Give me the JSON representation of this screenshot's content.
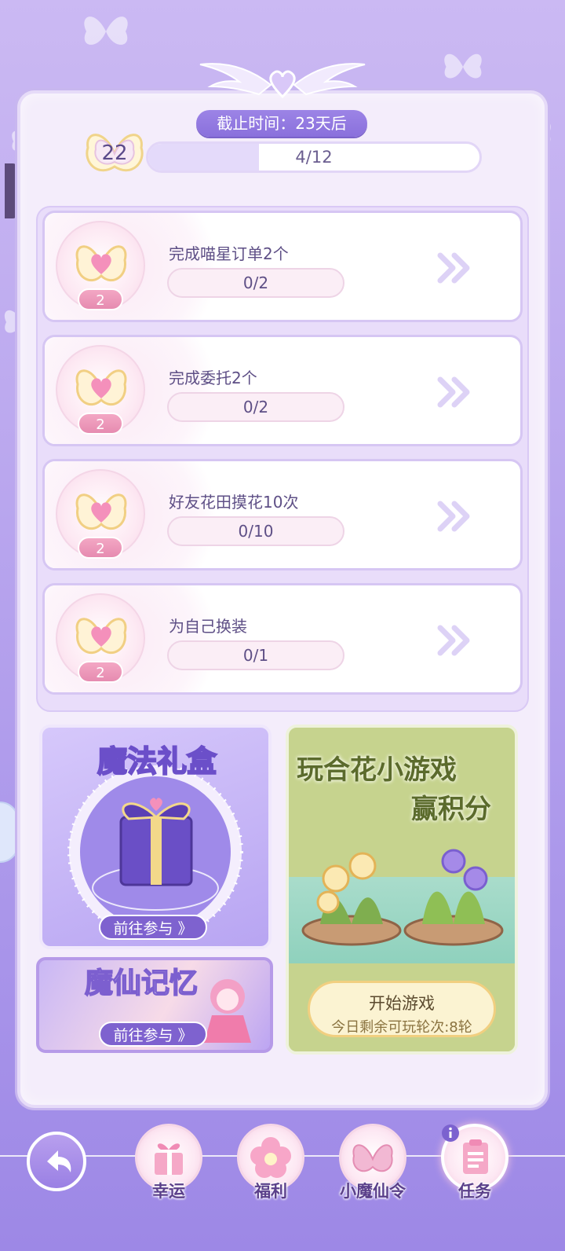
{
  "header": {
    "deadline": "截止时间：23天后",
    "level": "22",
    "progress_text": "4/12",
    "progress_fraction": 0.3333
  },
  "tasks": [
    {
      "title": "完成喵星订单2个",
      "progress": "0/2",
      "points": "2"
    },
    {
      "title": "完成委托2个",
      "progress": "0/2",
      "points": "2"
    },
    {
      "title": "好友花田摸花10次",
      "progress": "0/10",
      "points": "2"
    },
    {
      "title": "为自己换装",
      "progress": "0/1",
      "points": "2"
    }
  ],
  "events": {
    "magic_box": {
      "title": "魔法礼盒",
      "button": "前往参与 》"
    },
    "memory": {
      "title": "魔仙记忆",
      "button": "前往参与 》"
    },
    "mini_game": {
      "title_line1": "玩合花小游戏",
      "title_line2": "赢积分",
      "button": "开始游戏",
      "remaining": "今日剩余可玩轮次:8轮"
    }
  },
  "nav": [
    {
      "label": "幸运",
      "icon": "gift-icon"
    },
    {
      "label": "福利",
      "icon": "flower-icon"
    },
    {
      "label": "小魔仙令",
      "icon": "butterfly-badge-icon"
    },
    {
      "label": "任务",
      "icon": "clipboard-icon"
    }
  ],
  "colors": {
    "accent": "#8a70dc",
    "points_badge": "#e68bb0",
    "game_card": "#c6d38e"
  }
}
